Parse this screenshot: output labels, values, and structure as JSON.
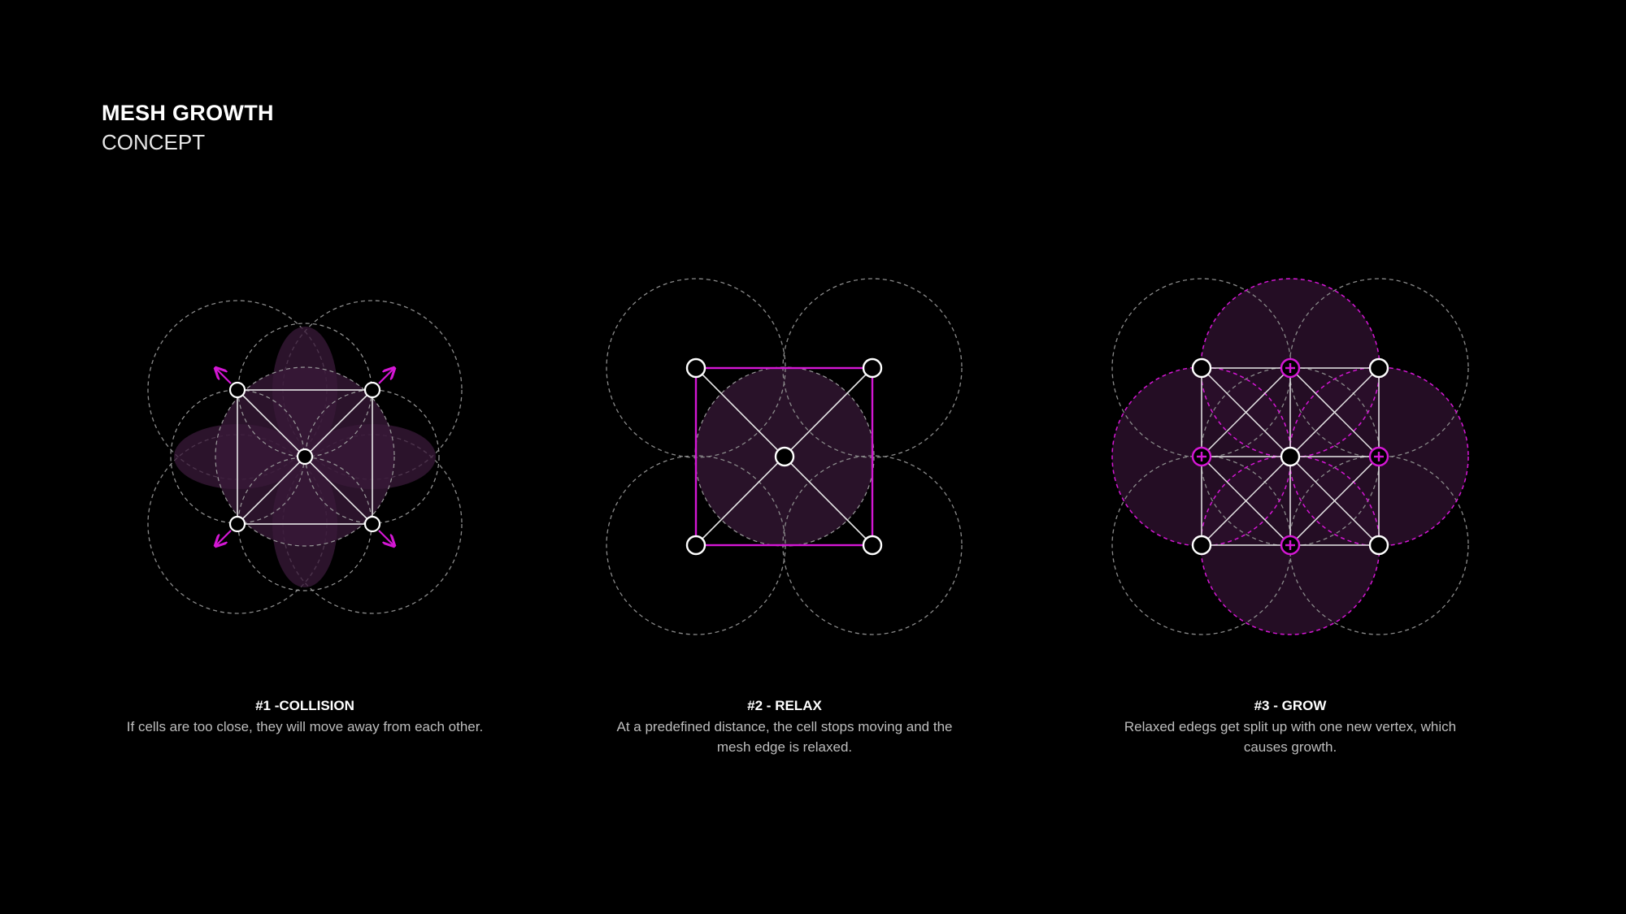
{
  "header": {
    "title": "MESH GROWTH",
    "subtitle": "CONCEPT"
  },
  "steps": [
    {
      "title": "#1 -COLLISION",
      "text": "If cells are too close, they will move away from each other."
    },
    {
      "title": "#2 - RELAX",
      "text": "At a predefined distance, the cell stops moving and the mesh edge is relaxed."
    },
    {
      "title": "#3 - GROW",
      "text": "Relaxed edegs get split up with one new vertex, which causes growth."
    }
  ],
  "colors": {
    "background": "#000000",
    "accent": "#d417d4",
    "fill": "#3a1a3a",
    "circle_outline": "#8a8a8a",
    "text": "#ffffff",
    "muted_text": "#bdbdbd"
  }
}
